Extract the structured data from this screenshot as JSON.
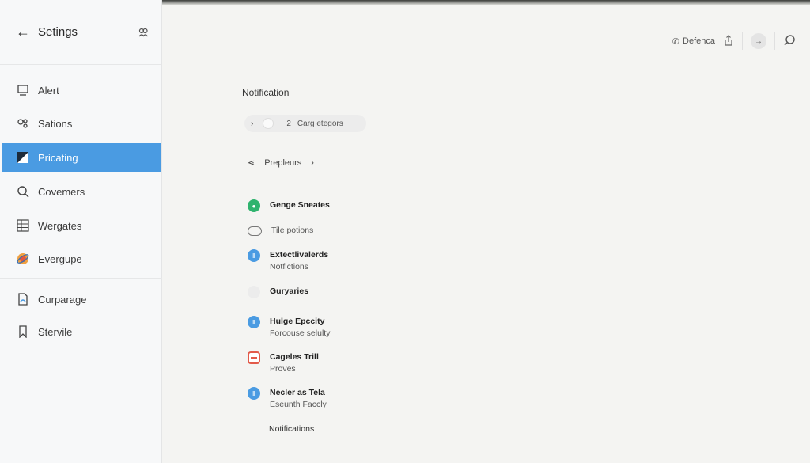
{
  "sidebar": {
    "title": "Setings",
    "items": [
      {
        "label": "Alert",
        "icon": "monitor-icon"
      },
      {
        "label": "Sations",
        "icon": "nodes-icon"
      },
      {
        "label": "Pricating",
        "icon": "square-icon",
        "active": true
      },
      {
        "label": "Covemers",
        "icon": "search-icon"
      },
      {
        "label": "Wergates",
        "icon": "grid-icon"
      },
      {
        "label": "Evergupe",
        "icon": "globe-icon"
      },
      {
        "label": "Curparage",
        "icon": "document-icon"
      },
      {
        "label": "Stervile",
        "icon": "bookmark-icon"
      }
    ]
  },
  "toolbar": {
    "defer_label": "Defenca"
  },
  "main": {
    "section_title": "Notification",
    "pill": {
      "count": "2",
      "label": "Carg etegors"
    },
    "crumb": {
      "label": "Prepleurs"
    },
    "entries": [
      {
        "title": "Genge Sneates",
        "subtitle": "",
        "color": "#2fb36e"
      },
      {
        "title": "Tile potions",
        "subtitle": "",
        "color": "outline"
      },
      {
        "title": "Extectlivalerds",
        "subtitle": "Notfictions",
        "color": "#4a9be2"
      },
      {
        "title": "Guryaries",
        "subtitle": "",
        "color": "none"
      },
      {
        "title": "Hulge Epccity",
        "subtitle": "Forcouse selulty",
        "color": "#4a9be2"
      },
      {
        "title": "Cageles Trill",
        "subtitle": "Proves",
        "color": "#e25a4a"
      },
      {
        "title": "Necler as Tela",
        "subtitle": "Eseunth Faccly",
        "color": "#4a9be2"
      }
    ],
    "footer_label": "Notifications"
  },
  "colors": {
    "accent": "#4a9be2",
    "green": "#2fb36e",
    "red": "#e25a4a"
  }
}
